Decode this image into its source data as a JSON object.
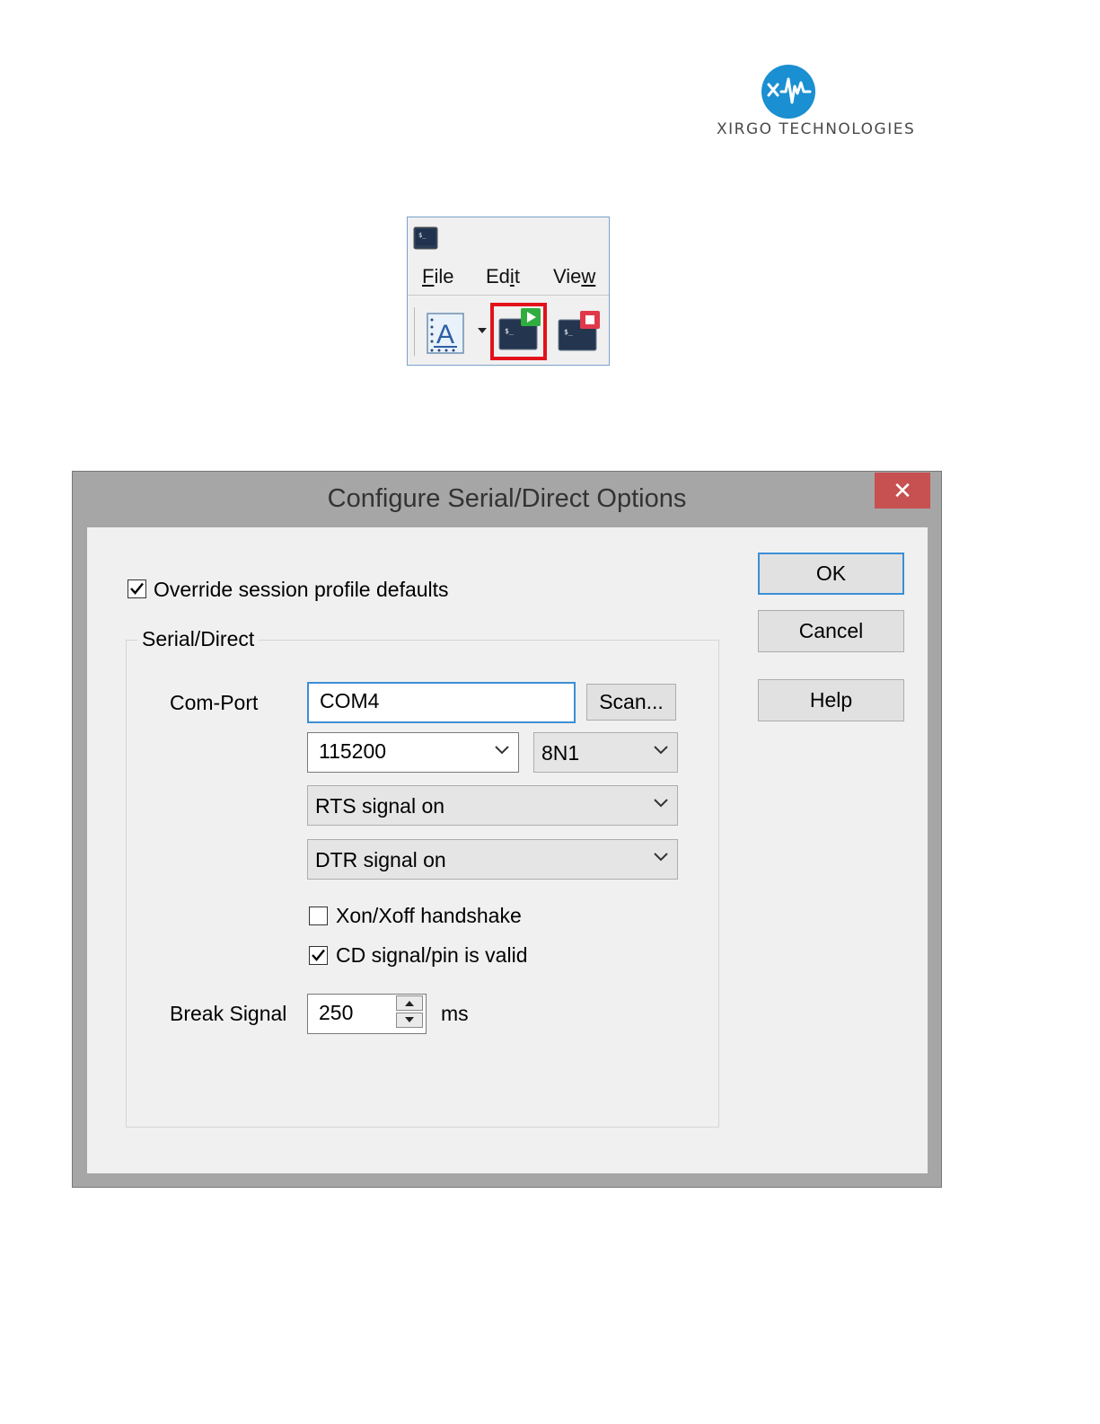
{
  "logo": {
    "company": "XIRGO TECHNOLOGIES",
    "accent_color": "#1a8fd1"
  },
  "toolbar": {
    "menus": [
      {
        "label_pre": "",
        "label_u": "F",
        "label_post": "ile"
      },
      {
        "label_pre": "Ed",
        "label_u": "i",
        "label_post": "t"
      },
      {
        "label_pre": "Vie",
        "label_u": "w",
        "label_post": ""
      }
    ],
    "icons": [
      "terminal-app-icon",
      "font-icon",
      "dropdown-arrow-icon",
      "connect-icon",
      "disconnect-icon"
    ],
    "highlight_color": "#e3121a"
  },
  "dialog": {
    "title": "Configure Serial/Direct Options",
    "close_label": "✕",
    "override_label": "Override session profile defaults",
    "override_checked": true,
    "group_title": "Serial/Direct",
    "com_port_label": "Com-Port",
    "com_port_value": "COM4",
    "scan_label": "Scan...",
    "baud_value": "115200",
    "format_value": "8N1",
    "rts_value": "RTS signal on",
    "dtr_value": "DTR signal on",
    "xon_label": "Xon/Xoff handshake",
    "xon_checked": false,
    "cd_label": "CD signal/pin is valid",
    "cd_checked": true,
    "break_label": "Break Signal",
    "break_value": "250",
    "break_unit": "ms",
    "ok_label": "OK",
    "cancel_label": "Cancel",
    "help_label": "Help"
  }
}
